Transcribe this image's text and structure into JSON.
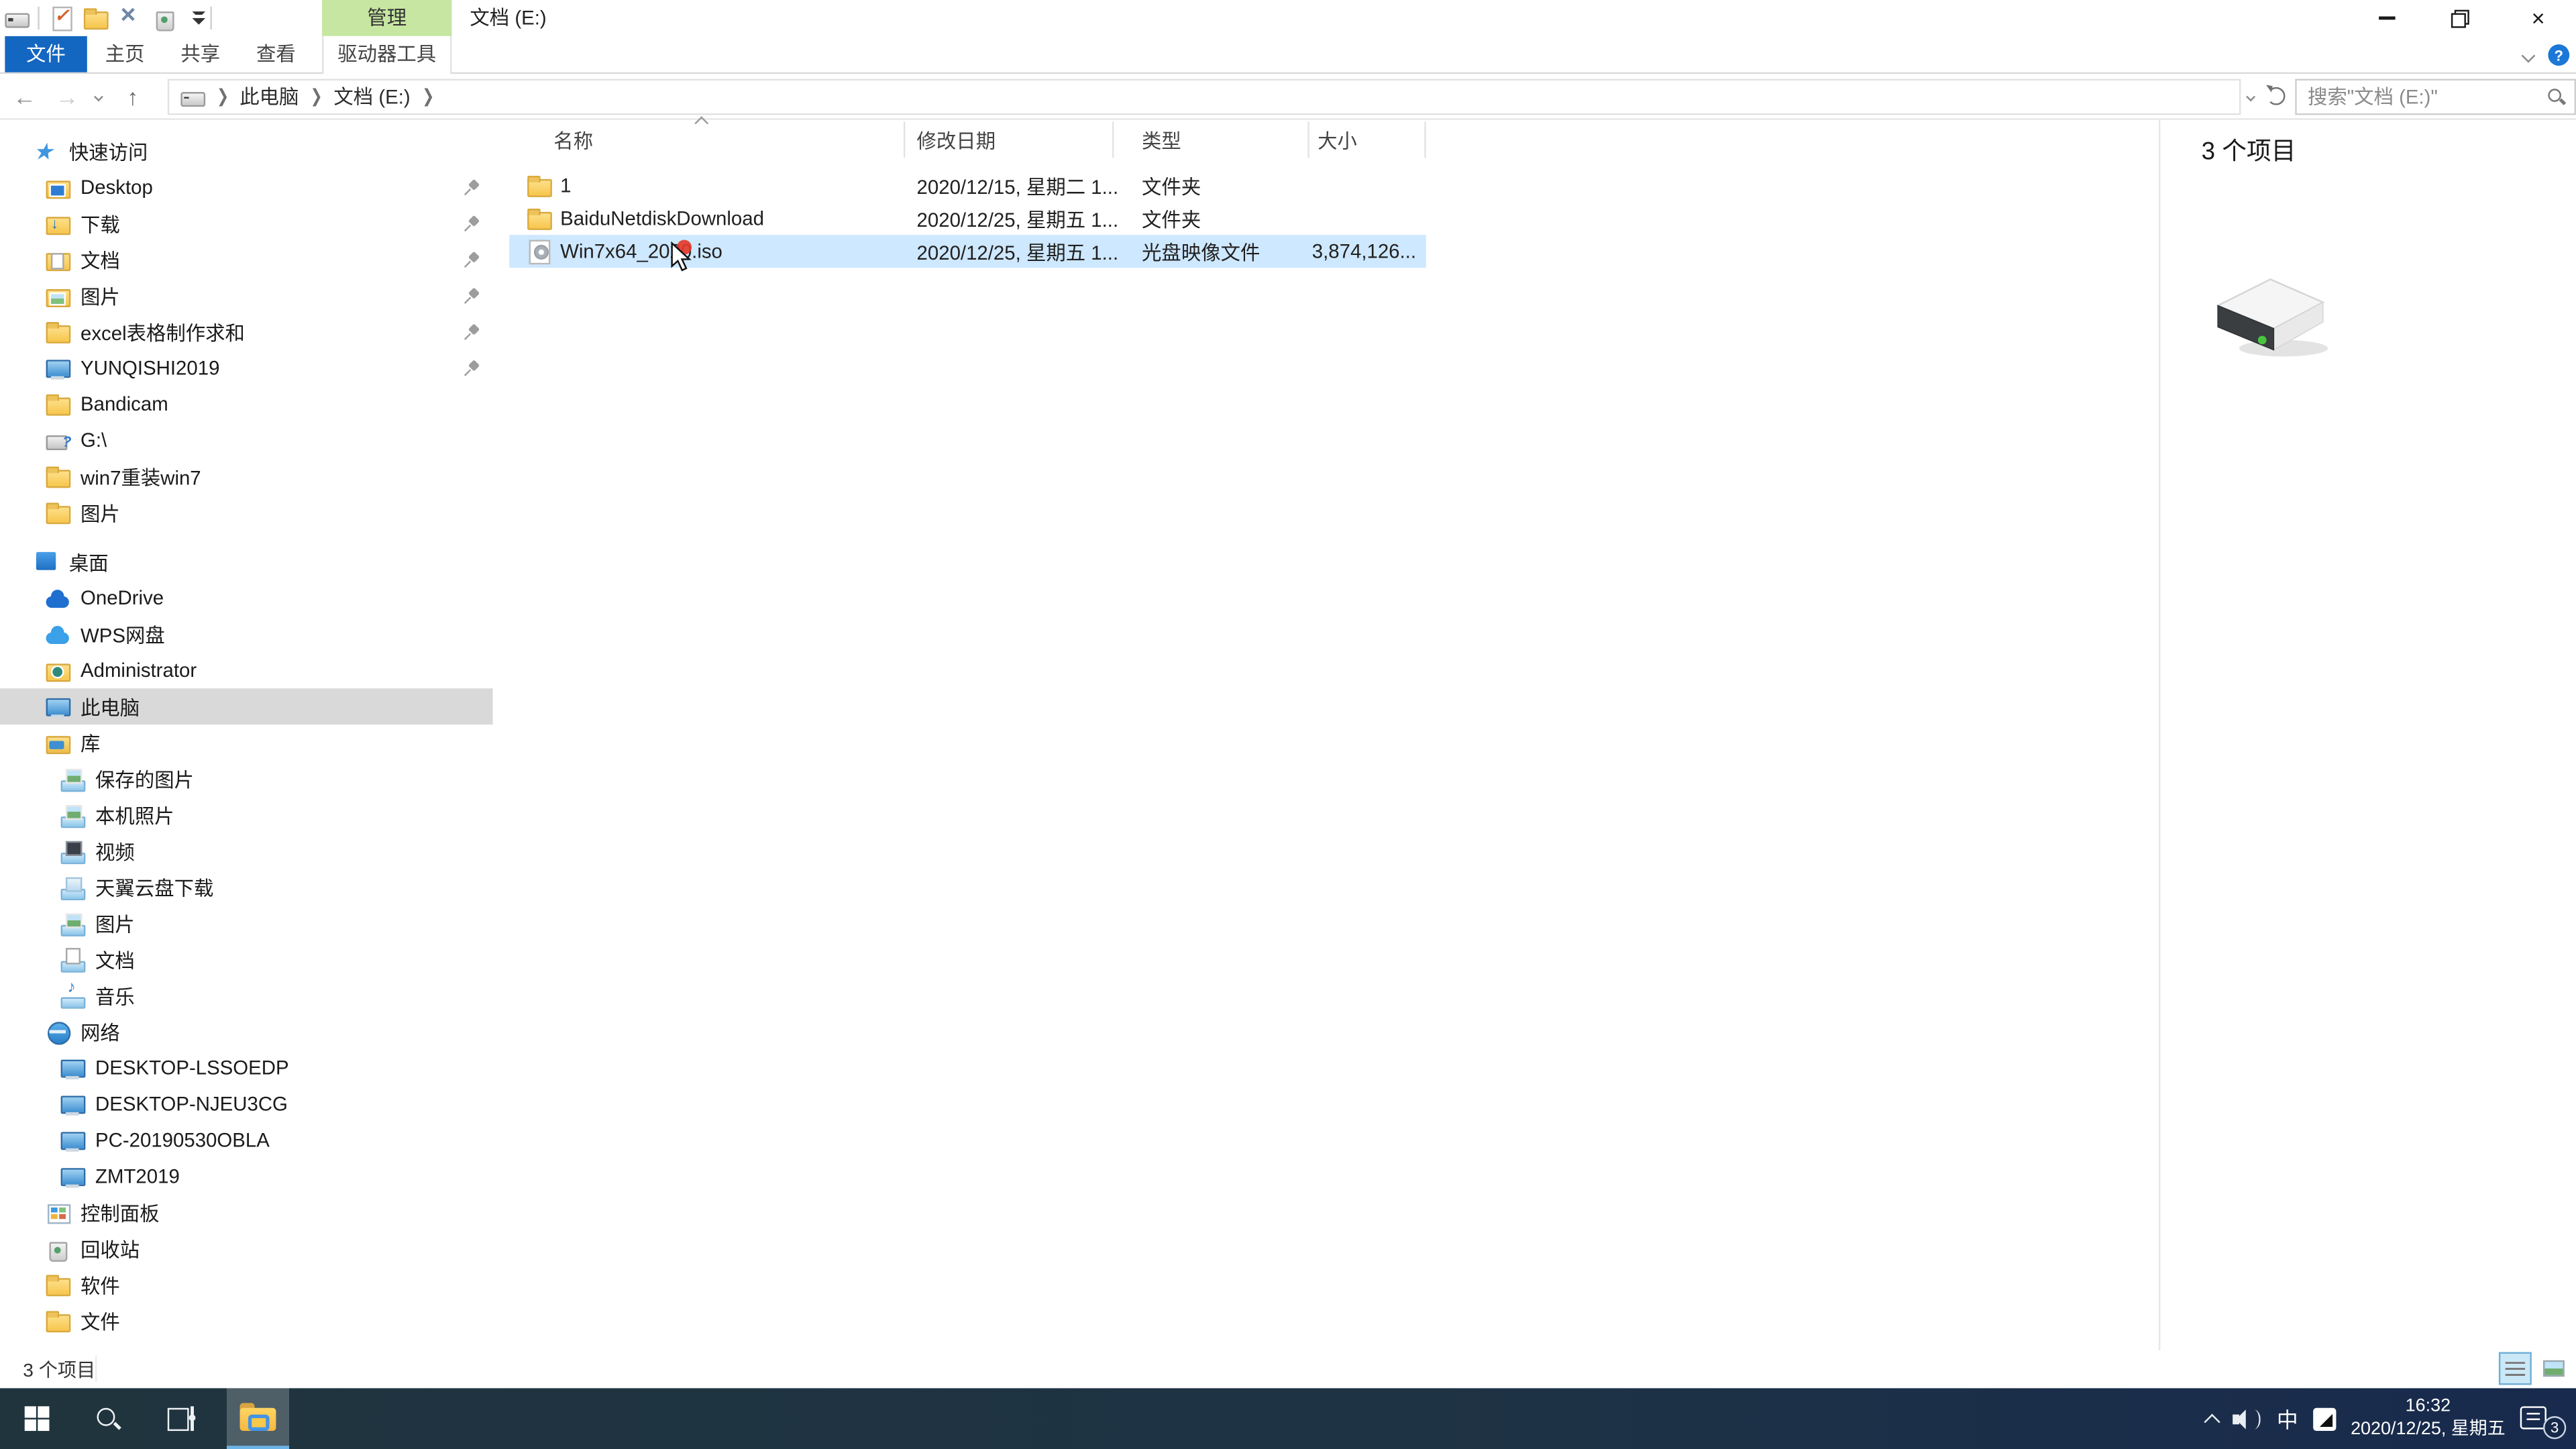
{
  "window": {
    "title": "文档 (E:)",
    "context_header": "管理",
    "controls": {
      "minimize": "minimize",
      "restore": "restore",
      "close": "close"
    }
  },
  "ribbon": {
    "file_tab": "文件",
    "tabs": [
      "主页",
      "共享",
      "查看"
    ],
    "context_tab": "驱动器工具"
  },
  "address_bar": {
    "breadcrumb": [
      "此电脑",
      "文档 (E:)"
    ],
    "search_placeholder": "搜索\"文档 (E:)\""
  },
  "sidebar": {
    "items": [
      {
        "label": "快速访问",
        "icon_class": "star",
        "icon_name": "quick-access-star-icon",
        "row_class": "lvl0"
      },
      {
        "label": "Desktop",
        "icon_class": "folder desktop",
        "icon_name": "desktop-folder-icon",
        "row_class": "lvl1",
        "pinned": true
      },
      {
        "label": "下载",
        "icon_class": "folder download",
        "icon_name": "downloads-folder-icon",
        "row_class": "lvl1",
        "pinned": true
      },
      {
        "label": "文档",
        "icon_class": "folder doc",
        "icon_name": "documents-folder-icon",
        "row_class": "lvl1",
        "pinned": true
      },
      {
        "label": "图片",
        "icon_class": "folder pic",
        "icon_name": "pictures-folder-icon",
        "row_class": "lvl1",
        "pinned": true
      },
      {
        "label": "excel表格制作求和",
        "icon_class": "folder",
        "icon_name": "folder-icon",
        "row_class": "lvl1",
        "pinned": true
      },
      {
        "label": "YUNQISHI2019",
        "icon_class": "pc",
        "icon_name": "computer-icon",
        "row_class": "lvl1",
        "pinned": true
      },
      {
        "label": "Bandicam",
        "icon_class": "folder",
        "icon_name": "folder-icon",
        "row_class": "lvl1"
      },
      {
        "label": "G:\\",
        "icon_class": "usb",
        "icon_name": "usb-drive-icon",
        "row_class": "lvl1"
      },
      {
        "label": "win7重装win7",
        "icon_class": "folder",
        "icon_name": "folder-icon",
        "row_class": "lvl1"
      },
      {
        "label": "图片",
        "icon_class": "folder",
        "icon_name": "folder-icon",
        "row_class": "lvl1"
      },
      {
        "label": "桌面",
        "icon_class": "desk",
        "icon_name": "desktop-icon",
        "row_class": "lvl0 gap"
      },
      {
        "label": "OneDrive",
        "icon_class": "cloud",
        "icon_name": "onedrive-icon",
        "row_class": "lvl1"
      },
      {
        "label": "WPS网盘",
        "icon_class": "cloud wps",
        "icon_name": "wps-cloud-icon",
        "row_class": "lvl1"
      },
      {
        "label": "Administrator",
        "icon_class": "folder user",
        "icon_name": "user-folder-icon",
        "row_class": "lvl1"
      },
      {
        "label": "此电脑",
        "icon_class": "pc",
        "icon_name": "this-pc-icon",
        "row_class": "lvl1 sel"
      },
      {
        "label": "库",
        "icon_class": "lib",
        "icon_name": "libraries-icon",
        "row_class": "lvl1"
      },
      {
        "label": "保存的图片",
        "icon_class": "libitem pic2",
        "icon_name": "saved-pictures-library-icon",
        "row_class": "lvl2"
      },
      {
        "label": "本机照片",
        "icon_class": "libitem pic2",
        "icon_name": "photos-library-icon",
        "row_class": "lvl2"
      },
      {
        "label": "视频",
        "icon_class": "libitem vid",
        "icon_name": "videos-library-icon",
        "row_class": "lvl2"
      },
      {
        "label": "天翼云盘下载",
        "icon_class": "libitem cld",
        "icon_name": "cloud-download-library-icon",
        "row_class": "lvl2"
      },
      {
        "label": "图片",
        "icon_class": "libitem pic2",
        "icon_name": "pictures-library-icon",
        "row_class": "lvl2"
      },
      {
        "label": "文档",
        "icon_class": "libitem doc2",
        "icon_name": "documents-library-icon",
        "row_class": "lvl2"
      },
      {
        "label": "音乐",
        "icon_class": "libitem mus",
        "icon_name": "music-library-icon",
        "row_class": "lvl2"
      },
      {
        "label": "网络",
        "icon_class": "globe",
        "icon_name": "network-icon",
        "row_class": "lvl1"
      },
      {
        "label": "DESKTOP-LSSOEDP",
        "icon_class": "pc",
        "icon_name": "network-computer-icon",
        "row_class": "lvl2"
      },
      {
        "label": "DESKTOP-NJEU3CG",
        "icon_class": "pc",
        "icon_name": "network-computer-icon",
        "row_class": "lvl2"
      },
      {
        "label": "PC-20190530OBLA",
        "icon_class": "pc",
        "icon_name": "network-computer-icon",
        "row_class": "lvl2"
      },
      {
        "label": "ZMT2019",
        "icon_class": "pc",
        "icon_name": "network-computer-icon",
        "row_class": "lvl2"
      },
      {
        "label": "控制面板",
        "icon_class": "cpanel",
        "icon_name": "control-panel-icon",
        "row_class": "lvl1"
      },
      {
        "label": "回收站",
        "icon_class": "bin",
        "icon_name": "recycle-bin-icon",
        "row_class": "lvl1"
      },
      {
        "label": "软件",
        "icon_class": "folder",
        "icon_name": "folder-icon",
        "row_class": "lvl1"
      },
      {
        "label": "文件",
        "icon_class": "folder",
        "icon_name": "folder-icon",
        "row_class": "lvl1"
      }
    ]
  },
  "file_list": {
    "columns": [
      "名称",
      "修改日期",
      "类型",
      "大小"
    ],
    "rows": [
      {
        "name": "1",
        "date": "2020/12/15, 星期二 1...",
        "type": "文件夹",
        "size": "",
        "icon_class": "folder",
        "icon_name": "folder-icon",
        "row_class": ""
      },
      {
        "name": "BaiduNetdiskDownload",
        "date": "2020/12/25, 星期五 1...",
        "type": "文件夹",
        "size": "",
        "icon_class": "folder",
        "icon_name": "folder-icon",
        "row_class": ""
      },
      {
        "name": "Win7x64_2020.iso",
        "date": "2020/12/25, 星期五 1...",
        "type": "光盘映像文件",
        "size": "3,874,126...",
        "icon_class": "iso",
        "icon_name": "disc-image-file-icon",
        "row_class": "sel"
      }
    ]
  },
  "preview_pane": {
    "item_count": "3 个项目"
  },
  "status_bar": {
    "item_count": "3 个项目"
  },
  "taskbar": {
    "ime_indicator": "中",
    "time": "16:32",
    "date": "2020/12/25, 星期五",
    "notification_badge": "3"
  },
  "icons": {
    "quick-access-toolbar": [
      "drive-icon",
      "checked-document-icon",
      "new-folder-icon",
      "delete-x-icon",
      "recycle-bin-icon",
      "toolbar-dropdown-icon"
    ],
    "taskbar": [
      "start-icon",
      "search-icon",
      "task-view-icon",
      "file-explorer-icon",
      "tray-expand-icon",
      "speaker-icon",
      "windows-ink-icon",
      "notification-icon"
    ]
  },
  "colors": {
    "file_tab_blue": "#1467c0",
    "manage_tab_green": "#c6e6a2",
    "selection_blue": "#cde8ff",
    "sidebar_selection_gray": "#d9d9d9",
    "taskbar_dark": "#20343e",
    "taskbar_accent_underline": "#6cb2e4"
  }
}
